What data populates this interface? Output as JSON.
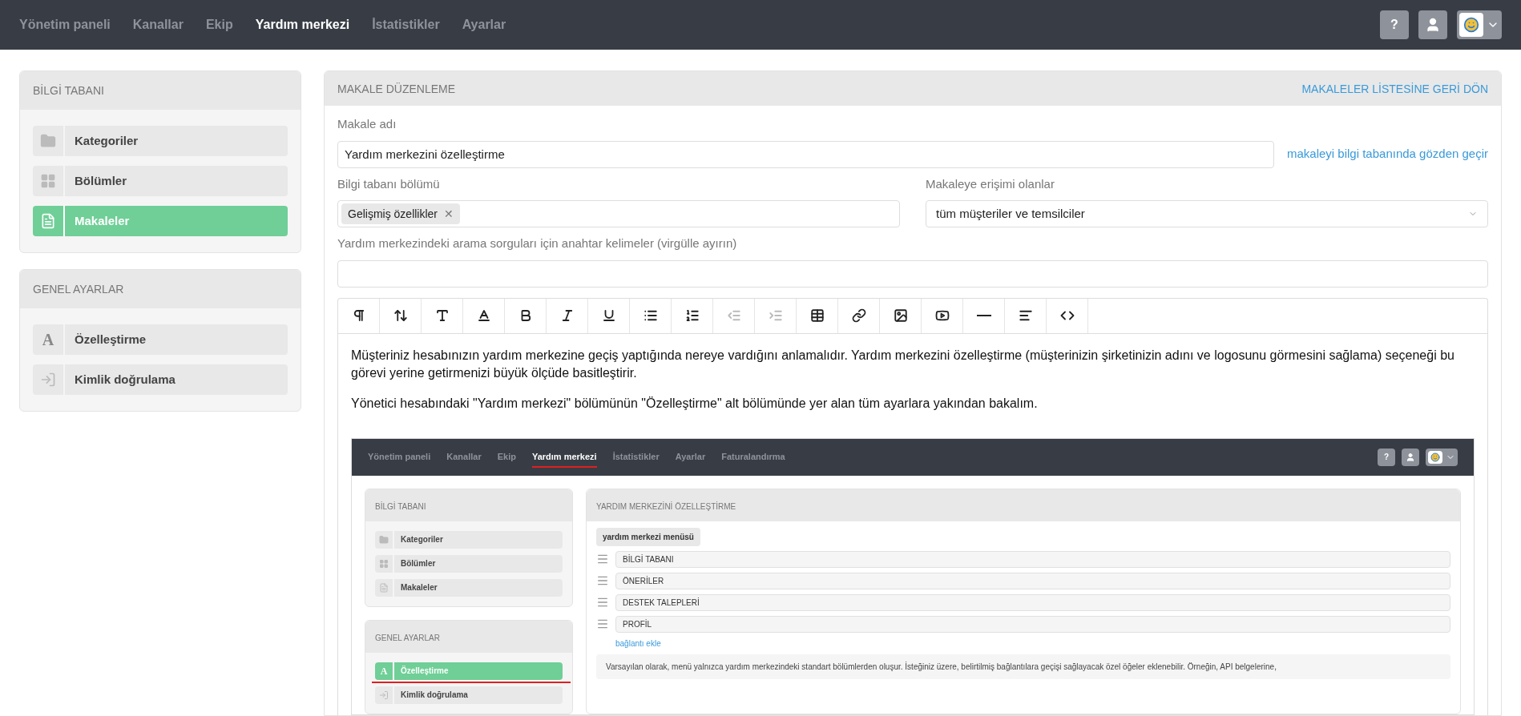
{
  "nav": {
    "items": [
      {
        "label": "Yönetim paneli",
        "selected": false
      },
      {
        "label": "Kanallar",
        "selected": false
      },
      {
        "label": "Ekip",
        "selected": false
      },
      {
        "label": "Yardım merkezi",
        "selected": true
      },
      {
        "label": "İstatistikler",
        "selected": false
      },
      {
        "label": "Ayarlar",
        "selected": false
      }
    ],
    "help": "?"
  },
  "sidebar": [
    {
      "title": "BİLGİ TABANI",
      "items": [
        {
          "label": "Kategoriler",
          "selected": false
        },
        {
          "label": "Bölümler",
          "selected": false
        },
        {
          "label": "Makaleler",
          "selected": true
        }
      ]
    },
    {
      "title": "GENEL AYARLAR",
      "items": [
        {
          "label": "Özelleştirme",
          "selected": false,
          "glyph": "A"
        },
        {
          "label": "Kimlik doğrulama",
          "selected": false
        }
      ]
    }
  ],
  "editor": {
    "title": "MAKALE DÜZENLEME",
    "back_link": "MAKALELER LİSTESİNE GERİ DÖN",
    "name_label": "Makale adı",
    "name_value": "Yardım merkezini özelleştirme",
    "preview_link": "makaleyi bilgi tabanında gözden geçir",
    "section_label": "Bilgi tabanı bölümü",
    "section_tags": [
      "Gelişmiş özellikler"
    ],
    "tag_remove": "✕",
    "access_label": "Makaleye erişimi olanlar",
    "access_value": "tüm müşteriler ve temsilciler",
    "keywords_label": "Yardım merkezindeki arama sorguları için anahtar kelimeler (virgülle ayırın)",
    "toolbar": [
      {
        "disabled": false
      },
      {
        "disabled": false
      },
      {
        "disabled": false
      },
      {
        "disabled": false
      },
      {
        "disabled": false
      },
      {
        "disabled": false
      },
      {
        "disabled": false
      },
      {
        "disabled": false
      },
      {
        "disabled": false
      },
      {
        "disabled": true
      },
      {
        "disabled": true
      },
      {
        "disabled": false
      },
      {
        "disabled": false
      },
      {
        "disabled": false
      },
      {
        "disabled": false
      },
      {
        "disabled": false
      },
      {
        "disabled": false
      },
      {
        "disabled": false
      }
    ],
    "paragraphs": [
      "Müşteriniz hesabınızın yardım merkezine geçiş yaptığında nereye vardığını anlamalıdır. Yardım merkezini özelleştirme (müşterinizin şirketinizin adını ve logosunu görmesini sağlama) seçeneği bu görevi yerine getirmenizi büyük ölçüde basitleştirir.",
      "Yönetici hesabındaki \"Yardım merkezi\" bölümünün \"Özelleştirme\" alt bölümünde yer alan tüm ayarlara yakından bakalım."
    ],
    "screenshot": {
      "nav": [
        {
          "label": "Yönetim paneli",
          "selected": false
        },
        {
          "label": "Kanallar",
          "selected": false
        },
        {
          "label": "Ekip",
          "selected": false
        },
        {
          "label": "Yardım merkezi",
          "selected": true
        },
        {
          "label": "İstatistikler",
          "selected": false
        },
        {
          "label": "Ayarlar",
          "selected": false
        },
        {
          "label": "Faturalandırma",
          "selected": false
        }
      ],
      "help": "?",
      "sidebar": [
        {
          "title": "BİLGİ TABANI",
          "items": [
            {
              "label": "Kategoriler",
              "selected": false
            },
            {
              "label": "Bölümler",
              "selected": false
            },
            {
              "label": "Makaleler",
              "selected": false
            }
          ]
        },
        {
          "title": "GENEL AYARLAR",
          "items": [
            {
              "label": "Özelleştirme",
              "selected": true,
              "glyph": "A"
            },
            {
              "label": "Kimlik doğrulama",
              "selected": false
            }
          ]
        }
      ],
      "panel_title": "YARDIM MERKEZİNİ ÖZELLEŞTİRME",
      "menu_tag": "yardım merkezi menüsü",
      "menu_items": [
        "BİLGİ TABANI",
        "ÖNERİLER",
        "DESTEK TALEPLERİ",
        "PROFİL"
      ],
      "add_link": "bağlantı ekle",
      "note": "Varsayılan olarak, menü yalnızca yardım merkezindeki standart bölümlerden oluşur. İsteğiniz üzere, belirtilmiş bağlantılara geçişi sağlayacak özel öğeler eklenebilir. Örneğin, API belgelerine,"
    }
  }
}
